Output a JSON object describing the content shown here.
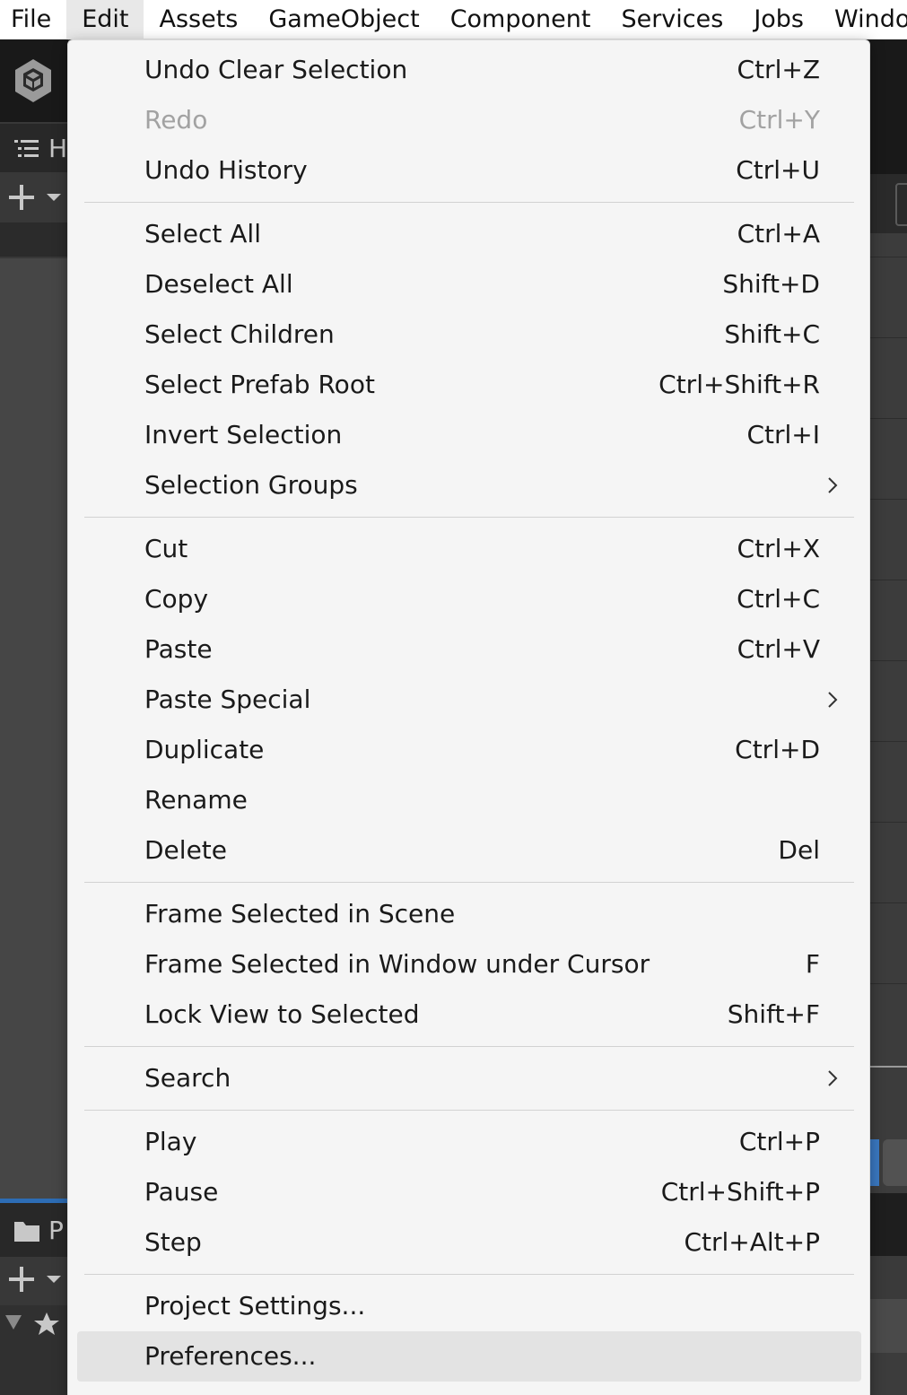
{
  "menubar": {
    "items": [
      {
        "label": "File"
      },
      {
        "label": "Edit",
        "active": true
      },
      {
        "label": "Assets"
      },
      {
        "label": "GameObject"
      },
      {
        "label": "Component"
      },
      {
        "label": "Services"
      },
      {
        "label": "Jobs"
      },
      {
        "label": "Windo"
      }
    ]
  },
  "background": {
    "hierarchy_tab_letter": "H",
    "project_tab_letter": "P",
    "hierarchy_add_icon": "plus-dropdown-icon",
    "project_add_icon": "plus-dropdown-icon",
    "favorites_icon": "star-icon",
    "logo_icon": "unity-logo-icon"
  },
  "edit_menu": {
    "groups": [
      {
        "items": [
          {
            "label": "Undo Clear Selection",
            "shortcut": "Ctrl+Z"
          },
          {
            "label": "Redo",
            "shortcut": "Ctrl+Y",
            "disabled": true
          },
          {
            "label": "Undo History",
            "shortcut": "Ctrl+U"
          }
        ]
      },
      {
        "items": [
          {
            "label": "Select All",
            "shortcut": "Ctrl+A"
          },
          {
            "label": "Deselect All",
            "shortcut": "Shift+D"
          },
          {
            "label": "Select Children",
            "shortcut": "Shift+C"
          },
          {
            "label": "Select Prefab Root",
            "shortcut": "Ctrl+Shift+R"
          },
          {
            "label": "Invert Selection",
            "shortcut": "Ctrl+I"
          },
          {
            "label": "Selection Groups",
            "shortcut": "",
            "submenu": true
          }
        ]
      },
      {
        "items": [
          {
            "label": "Cut",
            "shortcut": "Ctrl+X"
          },
          {
            "label": "Copy",
            "shortcut": "Ctrl+C"
          },
          {
            "label": "Paste",
            "shortcut": "Ctrl+V"
          },
          {
            "label": "Paste Special",
            "shortcut": "",
            "submenu": true
          },
          {
            "label": "Duplicate",
            "shortcut": "Ctrl+D"
          },
          {
            "label": "Rename",
            "shortcut": ""
          },
          {
            "label": "Delete",
            "shortcut": "Del"
          }
        ]
      },
      {
        "items": [
          {
            "label": "Frame Selected in Scene",
            "shortcut": ""
          },
          {
            "label": "Frame Selected in Window under Cursor",
            "shortcut": "F"
          },
          {
            "label": "Lock View to Selected",
            "shortcut": "Shift+F"
          }
        ]
      },
      {
        "items": [
          {
            "label": "Search",
            "shortcut": "",
            "submenu": true
          }
        ]
      },
      {
        "items": [
          {
            "label": "Play",
            "shortcut": "Ctrl+P"
          },
          {
            "label": "Pause",
            "shortcut": "Ctrl+Shift+P"
          },
          {
            "label": "Step",
            "shortcut": "Ctrl+Alt+P"
          }
        ]
      },
      {
        "items": [
          {
            "label": "Project Settings...",
            "shortcut": ""
          },
          {
            "label": "Preferences...",
            "shortcut": "",
            "hover": true
          }
        ]
      }
    ]
  }
}
